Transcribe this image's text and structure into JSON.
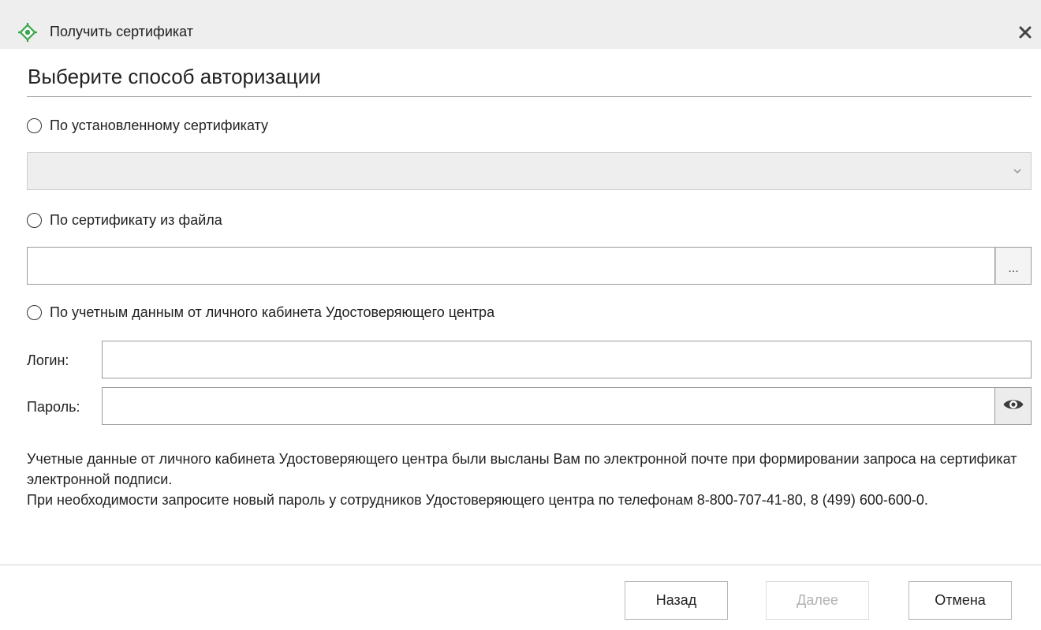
{
  "window": {
    "title": "Получить сертификат",
    "icon": "target-crosshair-icon",
    "close_icon": "close-icon"
  },
  "heading": "Выберите способ авторизации",
  "options": {
    "installed_certificate": {
      "label": "По установленному сертификату",
      "selected": false,
      "dropdown_value": ""
    },
    "certificate_file": {
      "label": "По сертификату из файла",
      "selected": false,
      "file_path": "",
      "browse_label": "..."
    },
    "credentials": {
      "label": "По учетным данным от личного кабинета Удостоверяющего центра",
      "selected": false
    }
  },
  "login": {
    "label": "Логин:",
    "value": ""
  },
  "password": {
    "label": "Пароль:",
    "value": "",
    "toggle_icon": "eye-icon"
  },
  "info": {
    "line1": "Учетные данные от личного кабинета Удостоверяющего центра были высланы Вам по электронной почте при формировании запроса на сертификат электронной подписи.",
    "line2": "При необходимости запросите новый пароль у сотрудников Удостоверяющего центра по телефонам 8-800-707-41-80, 8 (499) 600-600-0."
  },
  "footer": {
    "back_label": "Назад",
    "next_label": "Далее",
    "next_enabled": false,
    "cancel_label": "Отмена"
  },
  "colors": {
    "accent": "#3aa64a",
    "titlebar_bg": "#eeeeee",
    "disabled_text": "#b3b3b3"
  }
}
